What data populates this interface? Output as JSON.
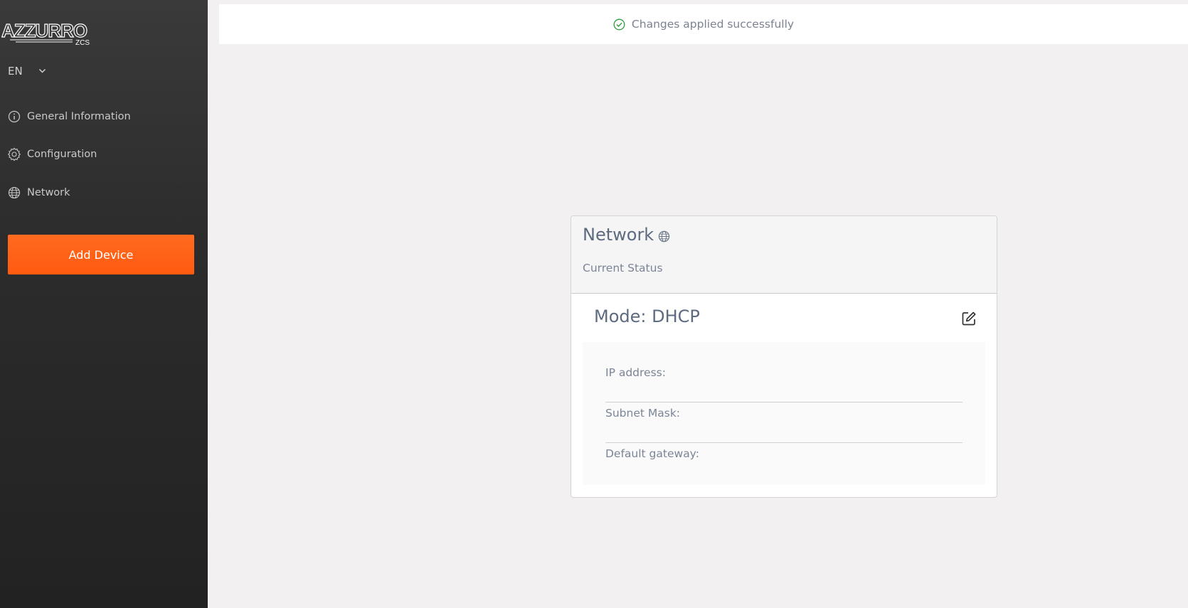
{
  "brand": {
    "logo_text": "AZZURRO",
    "logo_sub": "ZCS"
  },
  "language": {
    "selected": "EN"
  },
  "sidebar": {
    "items": [
      {
        "label": "General Information",
        "icon": "info-icon"
      },
      {
        "label": "Configuration",
        "icon": "gear-icon"
      },
      {
        "label": "Network",
        "icon": "globe-icon"
      }
    ],
    "add_button_label": "Add Device"
  },
  "toast": {
    "message": "Changes applied successfully",
    "icon": "check-circle-icon"
  },
  "network_card": {
    "title": "Network",
    "subtitle": "Current Status",
    "mode_label": "Mode: DHCP",
    "fields": [
      {
        "label": "IP address:"
      },
      {
        "label": "Subnet Mask:"
      },
      {
        "label": "Default gateway:"
      }
    ]
  },
  "colors": {
    "accent_orange": "#ff5f15",
    "sidebar_bg": "#2c2c2c",
    "success_green": "#2e9e3e",
    "text_slate": "#5d6b80"
  }
}
